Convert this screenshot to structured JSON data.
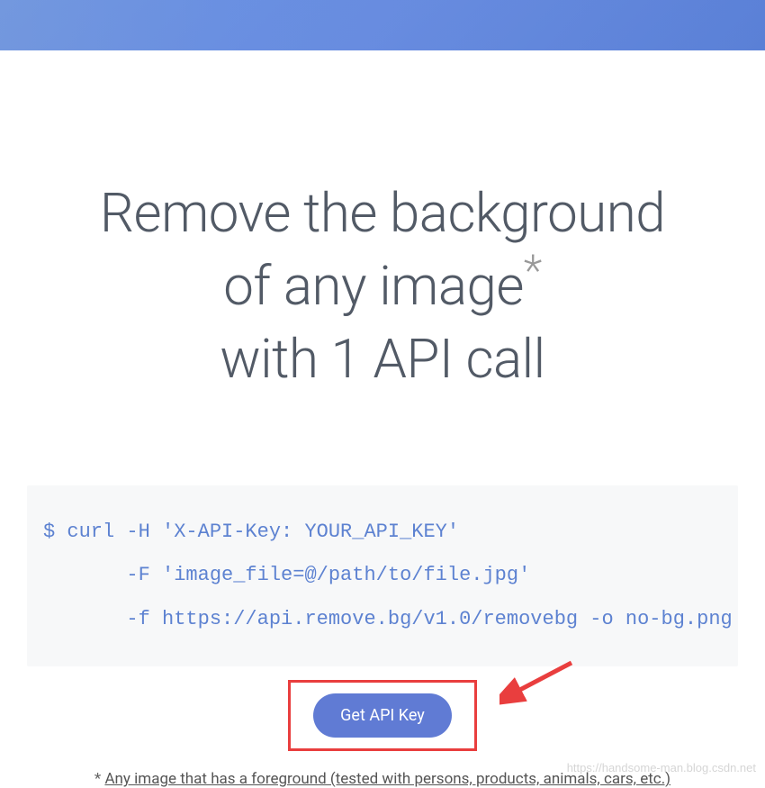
{
  "headline": {
    "line1": "Remove the background",
    "line2_before": "of any image",
    "asterisk": "*",
    "line3": "with 1 API call"
  },
  "code": {
    "line1": "$ curl -H 'X-API-Key: YOUR_API_KEY'",
    "line2": "       -F 'image_file=@/path/to/file.jpg'",
    "line3": "       -f https://api.remove.bg/v1.0/removebg -o no-bg.png"
  },
  "button": {
    "label": "Get API Key"
  },
  "footnote": {
    "marker": "* ",
    "text": "Any image that has a foreground (tested with persons, products, animals, cars, etc.)"
  },
  "watermark": "https://handsome-man.blog.csdn.net"
}
